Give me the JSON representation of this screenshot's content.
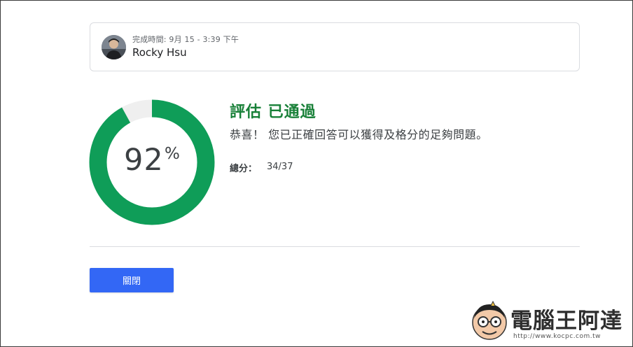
{
  "completion": {
    "meta": "完成時間: 9月 15 - 3:39 下午",
    "user_name": "Rocky Hsu"
  },
  "score": {
    "percent_value": 92,
    "percent_text": "92",
    "percent_sign": "%",
    "ring_color": "#0f9d58",
    "ring_remainder_color": "#efefef"
  },
  "result": {
    "title": "評估 已通過",
    "message": "恭喜！ 您已正確回答可以獲得及格分的足夠問題。",
    "total_label": "總分：",
    "total_value": "34/37"
  },
  "actions": {
    "close_label": "關閉"
  },
  "watermark": {
    "brand": "電腦王阿達",
    "url": "http://www.kocpc.com.tw"
  },
  "colors": {
    "title_green": "#188038",
    "button_blue": "#3367f5"
  }
}
